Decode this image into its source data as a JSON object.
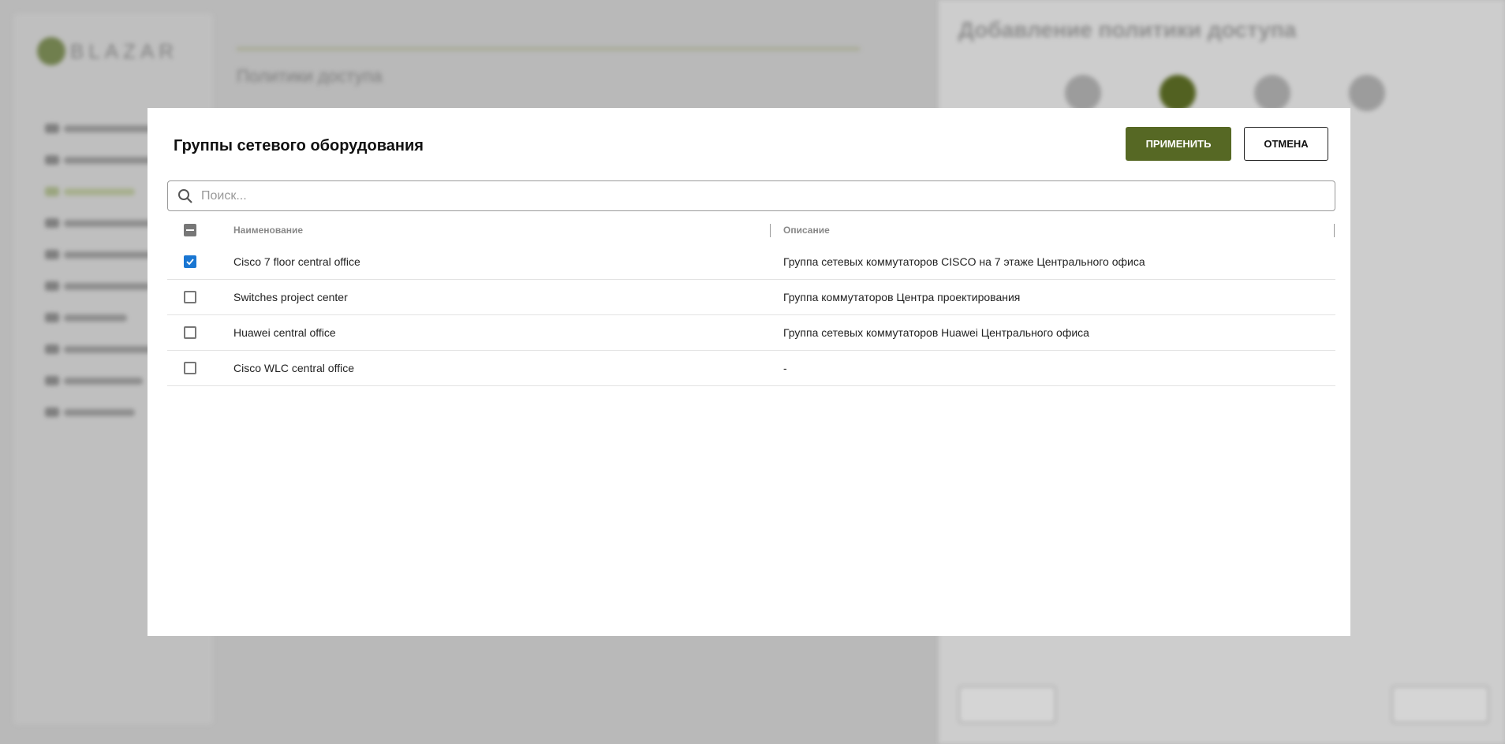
{
  "background": {
    "logo_text": "BLAZAR",
    "main_title": "Политики доступа",
    "panel_title": "Добавление политики доступа"
  },
  "modal": {
    "title": "Группы сетевого оборудования",
    "apply_label": "ПРИМЕНИТЬ",
    "cancel_label": "ОТМЕНА",
    "search_placeholder": "Поиск...",
    "search_value": "",
    "columns": {
      "name": "Наименование",
      "description": "Описание"
    },
    "select_all_state": "indeterminate",
    "rows": [
      {
        "name": "Cisco 7 floor central office",
        "description": "Группа сетевых коммутаторов CISCO на 7 этаже Центрального офиса",
        "checked": true
      },
      {
        "name": "Switches project center",
        "description": "Группа коммутаторов Центра проектирования",
        "checked": false
      },
      {
        "name": "Huawei central office",
        "description": "Группа сетевых коммутаторов Huawei Центрального офиса",
        "checked": false
      },
      {
        "name": "Cisco WLC central office",
        "description": "-",
        "checked": false
      }
    ]
  },
  "colors": {
    "accent": "#566824",
    "checkbox": "#1976d2"
  }
}
